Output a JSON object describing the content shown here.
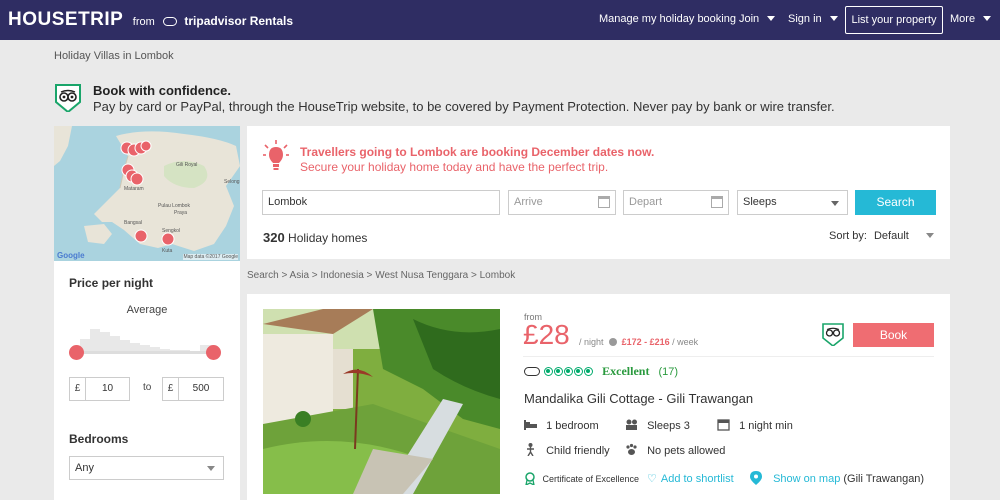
{
  "brand": {
    "name": "HOUSETRIP",
    "from": "from",
    "partner": "tripadvisor Rentals"
  },
  "nav": {
    "manage_booking": "Manage my holiday booking",
    "join": "Join",
    "sign_in": "Sign in",
    "list_property": "List your property",
    "more": "More"
  },
  "page_title": "Holiday Villas in Lombok",
  "banner": {
    "title": "Book with confidence.",
    "text": "Pay by card or PayPal, through the HouseTrip website, to be covered by Payment Protection. Never pay by bank or wire transfer."
  },
  "map": {
    "credit": "Map data ©2017 Google",
    "google": "Google",
    "place_labels": [
      "Mataram",
      "Gili Royal",
      "Pulau Lombok",
      "Selong",
      "Praya",
      "Sengkol",
      "Bangsal",
      "Kuta"
    ]
  },
  "filters": {
    "price_title": "Price per night",
    "price_sub": "Average",
    "currency": "£",
    "min": "10",
    "to": "to",
    "max": "500",
    "bedrooms_title": "Bedrooms",
    "bedrooms_value": "Any"
  },
  "search": {
    "promo_line1": "Travellers going to Lombok are booking December dates now.",
    "promo_line2": "Secure your holiday home today and have the perfect trip.",
    "location": "Lombok",
    "arrive_placeholder": "Arrive",
    "depart_placeholder": "Depart",
    "sleeps": "Sleeps",
    "button": "Search",
    "count": "320",
    "count_label": "Holiday homes",
    "sort_label": "Sort by:",
    "sort_value": "Default"
  },
  "breadcrumbs": [
    "Search",
    "Asia",
    "Indonesia",
    "West Nusa Tenggara",
    "Lombok"
  ],
  "listing": {
    "from": "from",
    "price": "£28",
    "per_night": "/ night",
    "week_range": "£172 - £216",
    "per_week": "/ week",
    "book": "Book",
    "rating_label": "Excellent",
    "reviews": "(17)",
    "bubbles": 5,
    "name": "Mandalika Gili Cottage - Gili Trawangan",
    "bedrooms": "1 bedroom",
    "sleeps": "Sleeps 3",
    "min_stay": "1 night min",
    "child": "Child friendly",
    "pets": "No pets allowed",
    "certificate": "Certificate of Excellence",
    "shortlist": "Add to shortlist",
    "show_map": "Show on map",
    "location": "(Gili Trawangan)"
  },
  "colors": {
    "nav_bg": "#2f2d63",
    "accent_red": "#e9636a",
    "accent_teal": "#25b9d6",
    "rating_green": "#2a9a3e"
  }
}
